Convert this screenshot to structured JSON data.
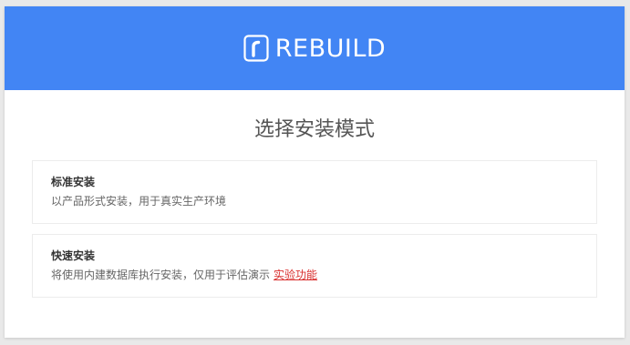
{
  "header": {
    "brand_name": "REBUILD",
    "logo_icon": "rebuild-logo-icon",
    "bg_color": "#4285f4"
  },
  "page": {
    "title": "选择安装模式"
  },
  "options": [
    {
      "title": "标准安装",
      "description": "以产品形式安装，用于真实生产环境"
    },
    {
      "title": "快速安装",
      "description": "将使用内建数据库执行安装，仅用于评估演示",
      "tag": "实验功能",
      "tag_color": "#d9302f"
    }
  ]
}
